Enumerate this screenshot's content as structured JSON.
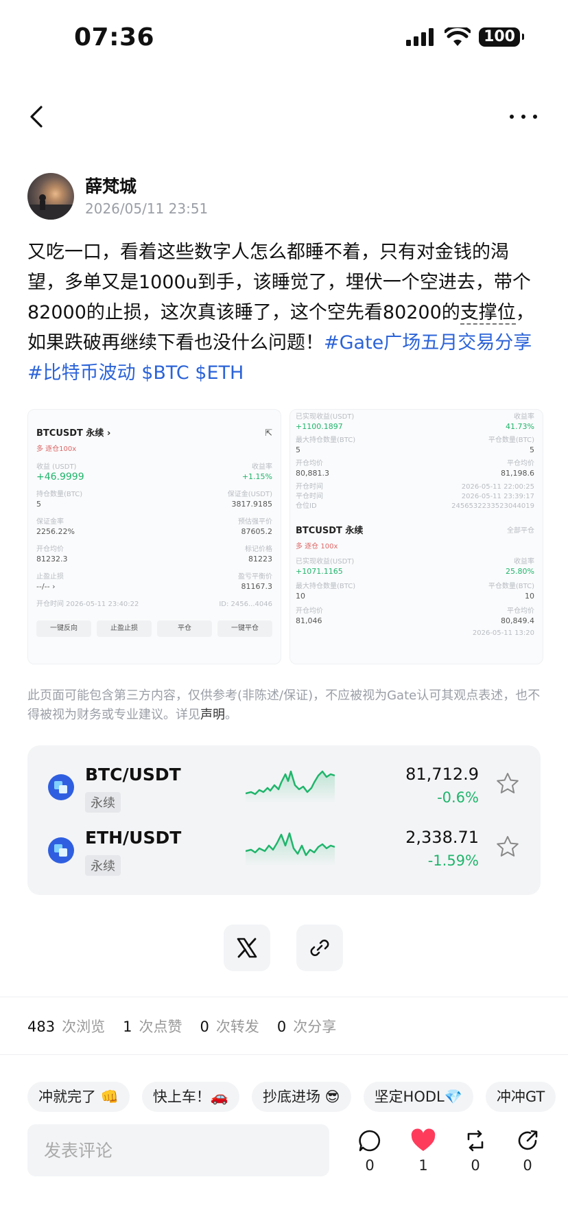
{
  "status": {
    "time": "07:36",
    "battery": "100"
  },
  "author": {
    "name": "薛梵城",
    "time": "2026/05/11 23:51"
  },
  "post": {
    "text_a": "又吃一口，看着这些数字人怎么都睡不着，只有对金钱的渴望，多单又是1000u到手，该睡觉了，埋伏一个空进去，带个82000的止损，这次真该睡了，这个空先看80200的",
    "text_b": "支撑位",
    "text_c": "，如果跌破再继续下看也没什么问题！",
    "tag1": "#Gate广场五月交易分享",
    "tag2": "#比特币波动",
    "tag3": "$BTC",
    "tag4": "$ETH"
  },
  "image_left": {
    "title": "BTCUSDT 永续 ›",
    "badge": "多   逐仓100x",
    "pnl_label": "收益 (USDT)",
    "pnl": "+46.9999",
    "roe_label": "收益率",
    "roe": "+1.15%",
    "size_label": "持仓数量(BTC)",
    "size": "5",
    "margin_label": "保证金(USDT)",
    "margin": "3817.9185",
    "ratio_label": "保证金率",
    "ratio": "2256.22%",
    "liq_label": "预估强平价",
    "liq": "87605.2",
    "entry_label": "开仓均价",
    "entry": "81232.3",
    "mark_label": "标记价格",
    "mark": "81223",
    "tp_label": "止盈止损",
    "tp": "--/-- ›",
    "be_label": "盈亏平衡价",
    "be": "81167.3",
    "time_label": "开仓时间 2026-05-11 23:40:22",
    "id_label": "ID: 2456...4046",
    "btn1": "一键反向",
    "btn2": "止盈止损",
    "btn3": "平仓",
    "btn4": "一键平仓"
  },
  "image_right": {
    "pnl1_label": "已实现收益(USDT)",
    "pnl1": "+1100.1897",
    "roe1_label": "收益率",
    "roe1": "41.73%",
    "size1_label": "最大持仓数量(BTC)",
    "size1": "5",
    "size1b_label": "平仓数量(BTC)",
    "size1b": "5",
    "entry1_label": "开仓均价",
    "entry1": "80,881.3",
    "close1_label": "平仓均价",
    "close1": "81,198.6",
    "open1_label": "开仓时间",
    "open1": "2026-05-11 22:00:25",
    "close1t_label": "平仓时间",
    "close1t": "2026-05-11 23:39:17",
    "pos1_label": "仓位ID",
    "pos1": "2456532233523044019",
    "title2": "BTCUSDT 永续",
    "title2_right": "全部平仓",
    "badge2": "多   逐仓 100x",
    "pnl2_label": "已实现收益(USDT)",
    "pnl2": "+1071.1165",
    "roe2_label": "收益率",
    "roe2": "25.80%",
    "size2_label": "最大持仓数量(BTC)",
    "size2": "10",
    "size2b_label": "平仓数量(BTC)",
    "size2b": "10",
    "entry2_label": "开仓均价",
    "entry2": "81,046",
    "close2_label": "平仓均价",
    "close2": "80,849.4",
    "open2": "2026-05-11 13:20"
  },
  "disclaimer": {
    "text": "此页面可能包含第三方内容，仅供参考(非陈述/保证)，不应被视为Gate认可其观点表述，也不得被视为财务或专业建议。详见",
    "link": "声明",
    "end": "。"
  },
  "markets": [
    {
      "pair": "BTC/USDT",
      "tag": "永续",
      "price": "81,712.9",
      "change": "-0.6%"
    },
    {
      "pair": "ETH/USDT",
      "tag": "永续",
      "price": "2,338.71",
      "change": "-1.59%"
    }
  ],
  "colors": {
    "up": "#1fb56b",
    "link": "#2b63d8",
    "like": "#ff3b5c",
    "icon_blue": "#2f5fe0"
  },
  "stats": {
    "views": "483",
    "views_label": "次浏览",
    "likes": "1",
    "likes_label": "次点赞",
    "reposts": "0",
    "reposts_label": "次转发",
    "shares": "0",
    "shares_label": "次分享"
  },
  "quick_replies": [
    "冲就完了 👊",
    "快上车！🚗",
    "抄底进场 😎",
    "坚定HODL💎",
    "冲冲GT"
  ],
  "comment": {
    "placeholder": "发表评论"
  },
  "actions": {
    "comment": "0",
    "like": "1",
    "repost": "0",
    "share": "0"
  }
}
